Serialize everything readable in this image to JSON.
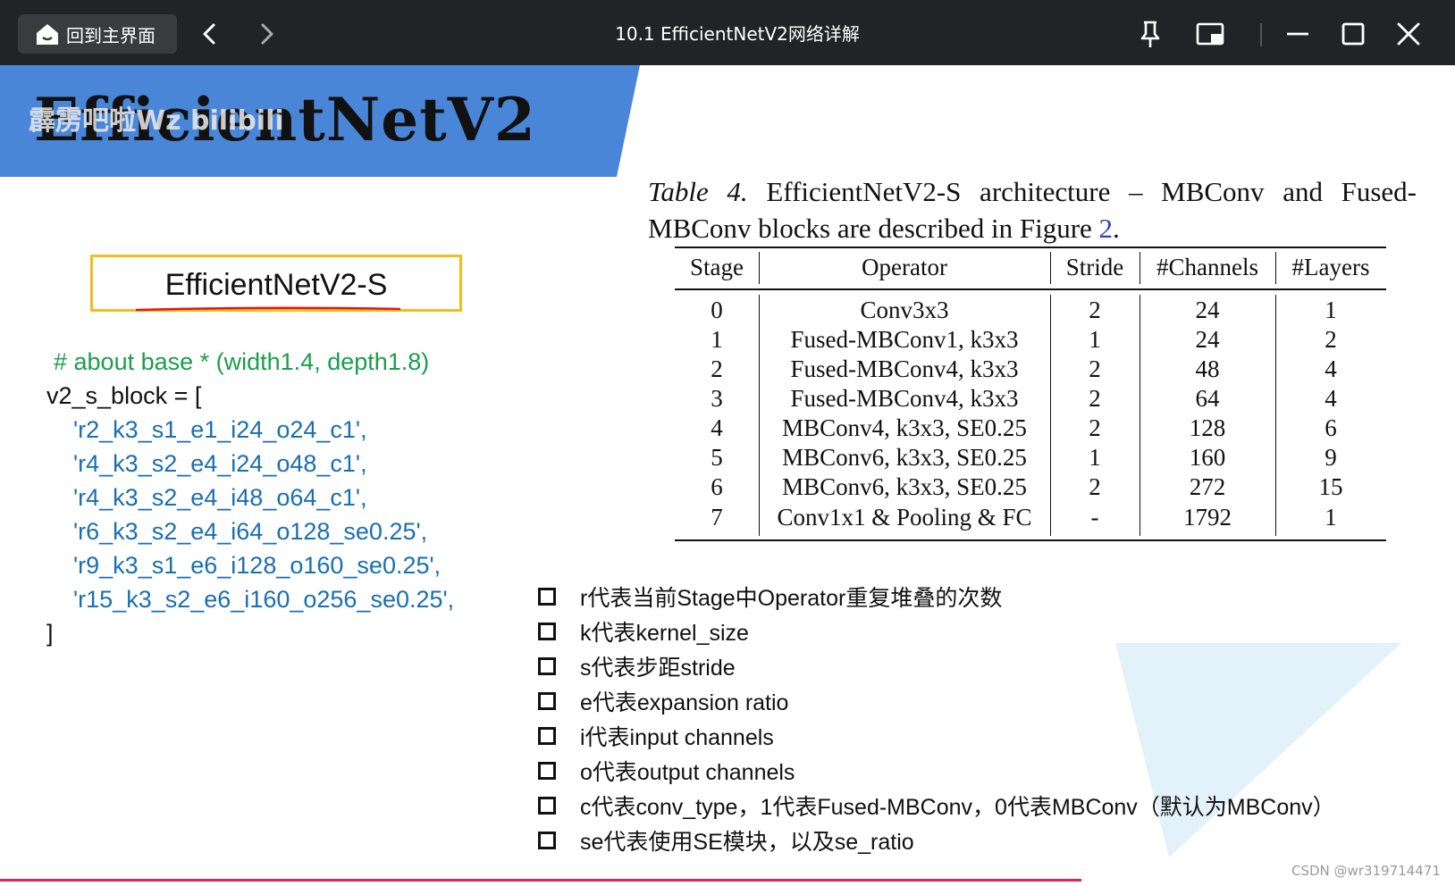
{
  "window": {
    "home_label": "回到主界面",
    "title": "10.1 EfficientNetV2网络详解",
    "icons": [
      "home-icon",
      "back-icon",
      "forward-icon",
      "pin-icon",
      "pip-icon",
      "minimize-icon",
      "maximize-icon",
      "close-icon"
    ]
  },
  "slide": {
    "title": "EfficientNetV2",
    "watermark": "霹雳吧啦Wz bilibili",
    "model_name": "EfficientNetV2-S",
    "code": {
      "comment": "# about base * (width1.4, depth1.8)",
      "open": "v2_s_block = [",
      "lines": [
        "'r2_k3_s1_e1_i24_o24_c1',",
        "'r4_k3_s2_e4_i24_o48_c1',",
        "'r4_k3_s2_e4_i48_o64_c1',",
        "'r6_k3_s2_e4_i64_o128_se0.25',",
        "'r9_k3_s1_e6_i128_o160_se0.25',",
        "'r15_k3_s2_e6_i160_o256_se0.25',"
      ],
      "close": "]"
    },
    "table": {
      "caption_prefix": "Table 4.",
      "caption_main": " EfficientNetV2-S architecture – MBConv and Fused-MBConv blocks are described in Figure ",
      "caption_fig": "2",
      "caption_end": ".",
      "headers": [
        "Stage",
        "Operator",
        "Stride",
        "#Channels",
        "#Layers"
      ],
      "rows": [
        [
          "0",
          "Conv3x3",
          "2",
          "24",
          "1"
        ],
        [
          "1",
          "Fused-MBConv1, k3x3",
          "1",
          "24",
          "2"
        ],
        [
          "2",
          "Fused-MBConv4, k3x3",
          "2",
          "48",
          "4"
        ],
        [
          "3",
          "Fused-MBConv4, k3x3",
          "2",
          "64",
          "4"
        ],
        [
          "4",
          "MBConv4, k3x3, SE0.25",
          "2",
          "128",
          "6"
        ],
        [
          "5",
          "MBConv6, k3x3, SE0.25",
          "1",
          "160",
          "9"
        ],
        [
          "6",
          "MBConv6, k3x3, SE0.25",
          "2",
          "272",
          "15"
        ],
        [
          "7",
          "Conv1x1 & Pooling & FC",
          "-",
          "1792",
          "1"
        ]
      ]
    },
    "bullets": [
      "r代表当前Stage中Operator重复堆叠的次数",
      "k代表kernel_size",
      "s代表步距stride",
      "e代表expansion ratio",
      "i代表input channels",
      "o代表output channels",
      "c代表conv_type，1代表Fused-MBConv，0代表MBConv（默认为MBConv）",
      "se代表使用SE模块，以及se_ratio"
    ],
    "footer_watermark": "CSDN @wr319714471"
  }
}
